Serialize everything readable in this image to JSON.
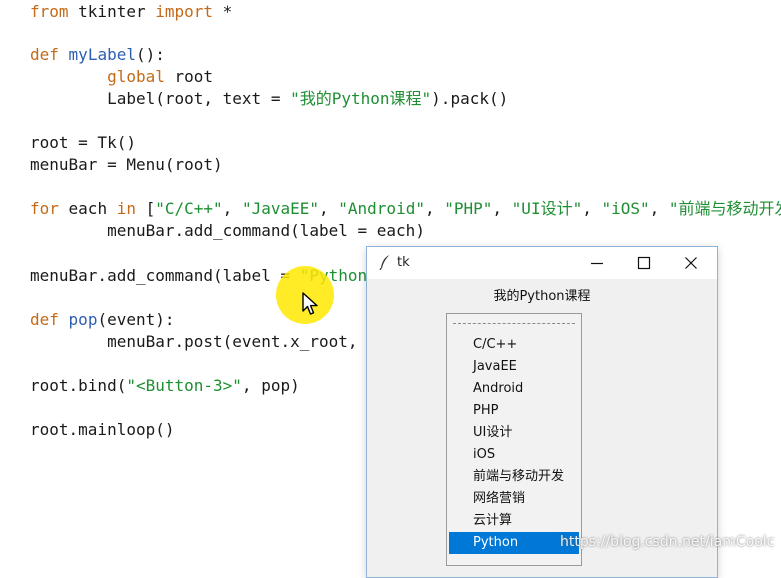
{
  "editor": {
    "lines": [
      {
        "parts": [
          [
            "kw",
            "from"
          ],
          [
            "pl",
            " tkinter "
          ],
          [
            "kw",
            "import"
          ],
          [
            "pl",
            " *"
          ]
        ]
      },
      {
        "parts": [
          [
            "kw",
            "def"
          ],
          [
            "pl",
            " "
          ],
          [
            "fn",
            "myLabel"
          ],
          [
            "pl",
            "():"
          ]
        ]
      },
      {
        "parts": [
          [
            "pl",
            "        "
          ],
          [
            "gl",
            "global"
          ],
          [
            "pl",
            " root"
          ]
        ]
      },
      {
        "parts": [
          [
            "pl",
            "        Label(root, text = "
          ],
          [
            "str",
            "\"我的Python课程\""
          ],
          [
            "pl",
            ").pack()"
          ]
        ]
      },
      {
        "parts": [
          [
            "pl",
            "root = Tk()"
          ]
        ]
      },
      {
        "parts": [
          [
            "pl",
            "menuBar = Menu(root)"
          ]
        ]
      },
      {
        "parts": [
          [
            "kw",
            "for"
          ],
          [
            "pl",
            " each "
          ],
          [
            "kw",
            "in"
          ],
          [
            "pl",
            " ["
          ],
          [
            "str",
            "\"C/C++\""
          ],
          [
            "pl",
            ", "
          ],
          [
            "str",
            "\"JavaEE\""
          ],
          [
            "pl",
            ", "
          ],
          [
            "str",
            "\"Android\""
          ],
          [
            "pl",
            ", "
          ],
          [
            "str",
            "\"PHP\""
          ],
          [
            "pl",
            ", "
          ],
          [
            "str",
            "\"UI设计\""
          ],
          [
            "pl",
            ", "
          ],
          [
            "str",
            "\"iOS\""
          ],
          [
            "pl",
            ", "
          ],
          [
            "str",
            "\"前端与移动开发"
          ]
        ]
      },
      {
        "parts": [
          [
            "pl",
            "        menuBar.add_command(label = each)"
          ]
        ]
      },
      {
        "parts": [
          [
            "pl",
            "menuBar.add_command(label = "
          ],
          [
            "str",
            "\"Python\""
          ]
        ]
      },
      {
        "parts": [
          [
            "kw",
            "def"
          ],
          [
            "pl",
            " "
          ],
          [
            "fn",
            "pop"
          ],
          [
            "pl",
            "(event):"
          ]
        ]
      },
      {
        "parts": [
          [
            "pl",
            "        menuBar.post(event.x_root, e"
          ]
        ]
      },
      {
        "parts": [
          [
            "pl",
            "root.bind("
          ],
          [
            "str",
            "\"<Button-3>\""
          ],
          [
            "pl",
            ", pop)"
          ]
        ]
      },
      {
        "parts": [
          [
            "pl",
            "root.mainloop()"
          ]
        ]
      }
    ]
  },
  "tk_window": {
    "title": "tk",
    "label_text": "我的Python课程"
  },
  "popup_menu": {
    "items": [
      "C/C++",
      "JavaEE",
      "Android",
      "PHP",
      "UI设计",
      "iOS",
      "前端与移动开发",
      "网络营销",
      "云计算",
      "Python"
    ],
    "active_item": "Python"
  },
  "watermark": "https://blog.csdn.net/iamCoolc",
  "colors": {
    "keyword": "#c46a18",
    "function": "#2d5fb0",
    "string": "#1f8f33",
    "menu_highlight": "#0078d7",
    "cursor_highlight": "#ffe800"
  }
}
